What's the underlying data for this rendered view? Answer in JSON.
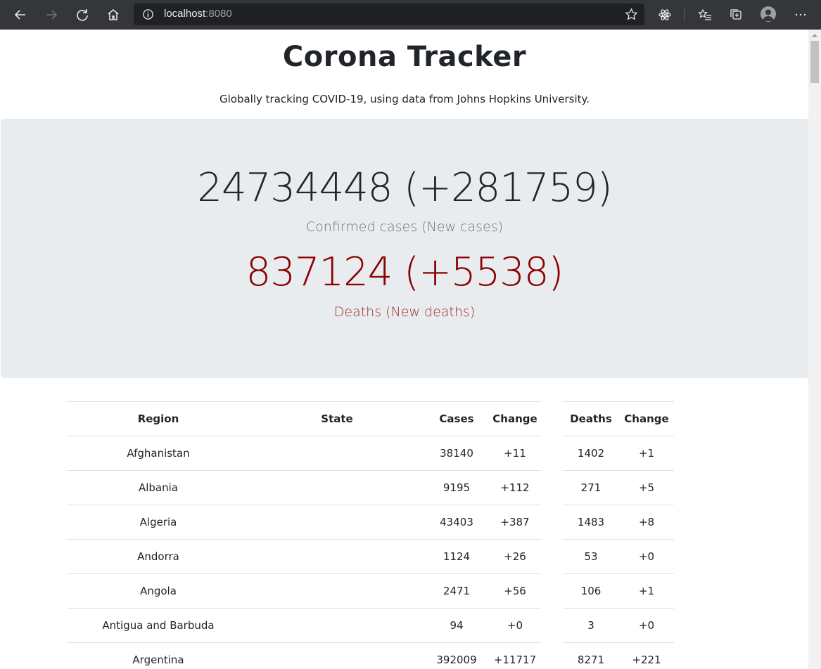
{
  "browser": {
    "url_host": "localhost",
    "url_port": ":8080"
  },
  "page": {
    "title": "Corona Tracker",
    "subtitle": "Globally tracking COVID-19, using data from Johns Hopkins University.",
    "confirmed_value": "24734448 (+281759)",
    "confirmed_label": "Confirmed cases (New cases)",
    "deaths_value": "837124 (+5538)",
    "deaths_label": "Deaths (New deaths)"
  },
  "table": {
    "headers": {
      "region": "Region",
      "state": "State",
      "cases": "Cases",
      "cases_change": "Change",
      "deaths": "Deaths",
      "deaths_change": "Change"
    },
    "rows": [
      {
        "region": "Afghanistan",
        "state": "",
        "cases": "38140",
        "cases_change": "+11",
        "deaths": "1402",
        "deaths_change": "+1"
      },
      {
        "region": "Albania",
        "state": "",
        "cases": "9195",
        "cases_change": "+112",
        "deaths": "271",
        "deaths_change": "+5"
      },
      {
        "region": "Algeria",
        "state": "",
        "cases": "43403",
        "cases_change": "+387",
        "deaths": "1483",
        "deaths_change": "+8"
      },
      {
        "region": "Andorra",
        "state": "",
        "cases": "1124",
        "cases_change": "+26",
        "deaths": "53",
        "deaths_change": "+0"
      },
      {
        "region": "Angola",
        "state": "",
        "cases": "2471",
        "cases_change": "+56",
        "deaths": "106",
        "deaths_change": "+1"
      },
      {
        "region": "Antigua and Barbuda",
        "state": "",
        "cases": "94",
        "cases_change": "+0",
        "deaths": "3",
        "deaths_change": "+0"
      },
      {
        "region": "Argentina",
        "state": "",
        "cases": "392009",
        "cases_change": "+11717",
        "deaths": "8271",
        "deaths_change": "+221"
      }
    ]
  }
}
